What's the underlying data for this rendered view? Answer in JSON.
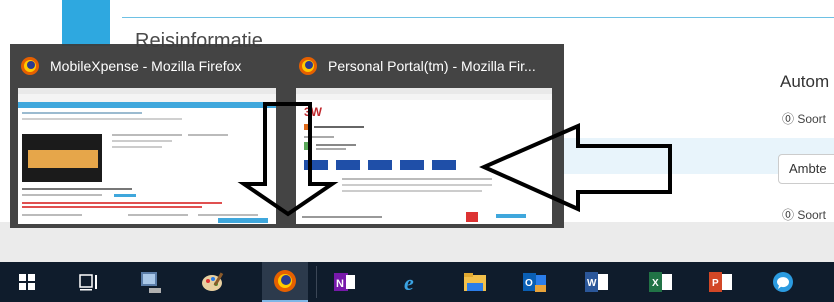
{
  "background": {
    "heading": "Reisinformatie",
    "right_title": "Autom",
    "soort_1": "⓪ Soort",
    "select_value": "Ambte",
    "soort_2": "⓪ Soort"
  },
  "thumbnails": [
    {
      "title": "MobileXpense - Mozilla Firefox",
      "icon": "firefox-icon"
    },
    {
      "title": "Personal Portal(tm) - Mozilla Fir...",
      "icon": "firefox-icon"
    }
  ],
  "taskbar": {
    "items": [
      "windows-start-icon",
      "task-view-icon",
      "computer-icon",
      "paint-icon",
      "firefox-icon",
      "onenote-icon",
      "internet-explorer-icon",
      "file-explorer-icon",
      "outlook-icon",
      "word-icon",
      "excel-icon",
      "powerpoint-icon",
      "chat-icon"
    ]
  },
  "colors": {
    "taskbar": "#0f1c2c",
    "popup": "#3c3c3c",
    "accent": "#2ea8e0"
  }
}
